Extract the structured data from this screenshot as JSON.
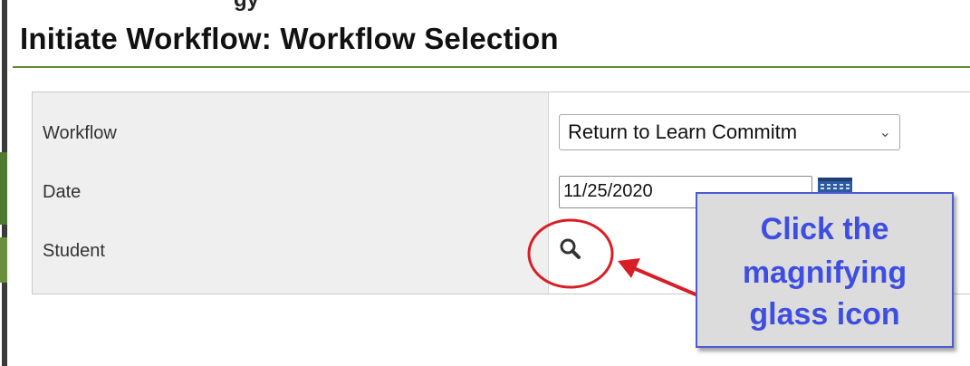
{
  "header": {
    "cut_text": "gy",
    "title": "Initiate Workflow: Workflow Selection"
  },
  "form": {
    "workflow_label": "Workflow",
    "workflow_value": "Return to Learn Commitm",
    "date_label": "Date",
    "date_value": "11/25/2020",
    "student_label": "Student"
  },
  "icons": {
    "select_chevron": "chevron-down-icon",
    "calendar": "calendar-icon",
    "student_search": "magnifying-glass-icon"
  },
  "annotation": {
    "callout_lines": [
      "Click the",
      "magnifying",
      "glass icon"
    ],
    "circle_color": "#d81e25",
    "arrow_color": "#d81e25",
    "callout_text_color": "#3e4ee0",
    "callout_border_color": "#4d5ad0"
  },
  "colors": {
    "title_rule": "#5e8c3a",
    "label_column_bg": "#efefef"
  }
}
